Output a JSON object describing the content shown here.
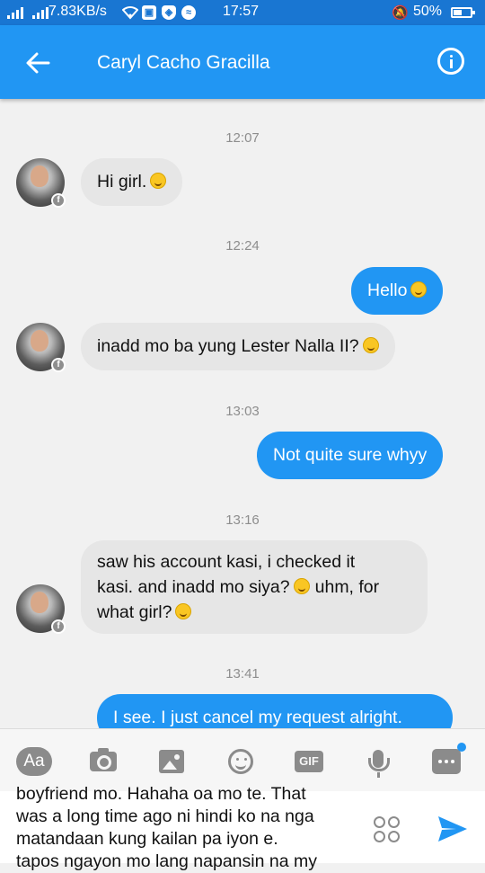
{
  "status_bar": {
    "network_speed": "7.83KB/s",
    "time": "17:57",
    "battery_percent": "50%"
  },
  "header": {
    "contact_name": "Caryl Cacho Gracilla"
  },
  "thread": [
    {
      "type": "timestamp",
      "text": "12:07"
    },
    {
      "type": "incoming",
      "text": "Hi girl.",
      "emoji": "wink-smile"
    },
    {
      "type": "timestamp",
      "text": "12:24"
    },
    {
      "type": "outgoing",
      "text": "Hello",
      "emoji": "smile"
    },
    {
      "type": "incoming",
      "text": "inadd mo ba yung Lester Nalla II?",
      "emoji": "smile"
    },
    {
      "type": "timestamp",
      "text": "13:03"
    },
    {
      "type": "outgoing",
      "text": "Not quite sure whyy"
    },
    {
      "type": "timestamp",
      "text": "13:16"
    },
    {
      "type": "incoming",
      "lines": [
        "saw his account kasi, i checked it",
        "kasi. and inadd mo siya?",
        "uhm, for",
        "what girl?"
      ]
    },
    {
      "type": "timestamp",
      "text": "13:41"
    },
    {
      "type": "outgoing",
      "text": "I see. I just cancel my request alright."
    }
  ],
  "toolbar": {
    "aa_label": "Aa",
    "gif_label": "GIF"
  },
  "composer": {
    "draft_lines": [
      "boyfriend mo. Hahaha oa mo te. That",
      "was a long time ago ni hindi ko na nga",
      "matandaan kung kailan pa iyon e.",
      "tapos ngayon mo lang napansin na my"
    ]
  },
  "colors": {
    "accent": "#2196f3",
    "incoming_bubble": "#e6e6e6"
  }
}
